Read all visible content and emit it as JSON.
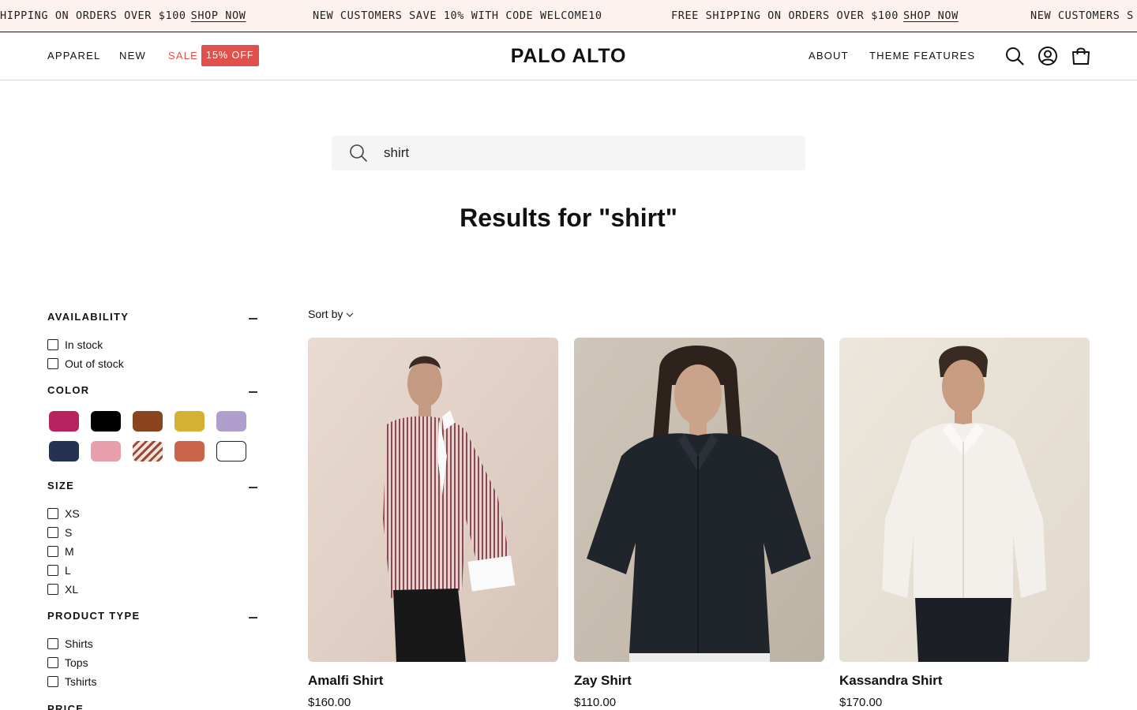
{
  "announcement": {
    "shipping_text": "FREE SHIPPING ON ORDERS OVER $100",
    "shipping_text_clipped": "HIPPING ON ORDERS OVER $100",
    "shop_link": "SHOP NOW",
    "welcome_text": "NEW CUSTOMERS SAVE 10% WITH CODE WELCOME10",
    "welcome_text_clipped": "NEW CUSTOMERS S"
  },
  "header": {
    "logo": "PALO ALTO",
    "nav_left": [
      "APPAREL",
      "NEW",
      "SALE"
    ],
    "sale_badge": "15% OFF",
    "nav_right": [
      "ABOUT",
      "THEME FEATURES"
    ],
    "icons": [
      "search-icon",
      "account-icon",
      "cart-icon"
    ]
  },
  "search": {
    "query": "shirt",
    "results_title": "Results for \"shirt\""
  },
  "filters": {
    "availability": {
      "title": "AVAILABILITY",
      "options": [
        "In stock",
        "Out of stock"
      ]
    },
    "color": {
      "title": "COLOR",
      "swatches": [
        "#b8225e",
        "#000000",
        "#8a4520",
        "#d6b032",
        "#b09fcc",
        "#243352",
        "#e89fac",
        "zebra",
        "#c9654a",
        "#ffffff"
      ]
    },
    "size": {
      "title": "SIZE",
      "options": [
        "XS",
        "S",
        "M",
        "L",
        "XL"
      ]
    },
    "product_type": {
      "title": "PRODUCT TYPE",
      "options": [
        "Shirts",
        "Tops",
        "Tshirts"
      ]
    },
    "price": {
      "title": "PRICE"
    }
  },
  "sort": {
    "label": "Sort by"
  },
  "products": [
    {
      "name": "Amalfi Shirt",
      "price": "$160.00"
    },
    {
      "name": "Zay Shirt",
      "price": "$110.00"
    },
    {
      "name": "Kassandra Shirt",
      "price": "$170.00"
    }
  ]
}
